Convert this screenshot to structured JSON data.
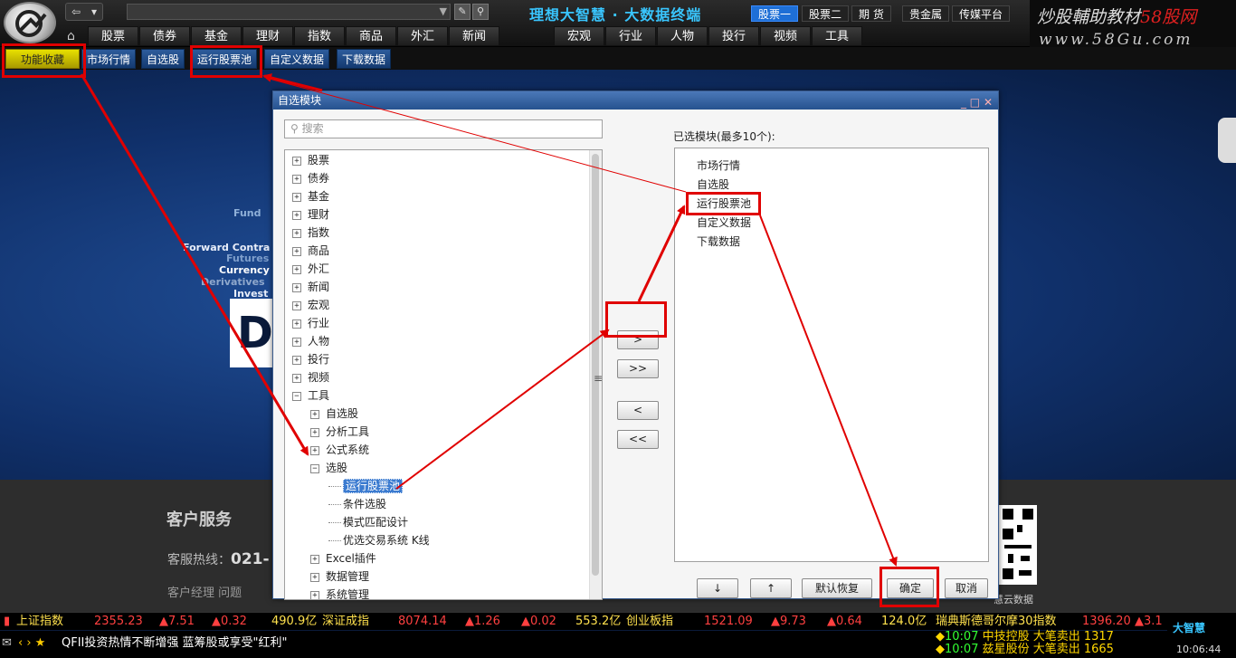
{
  "toolbar": {
    "brand": "理想大智慧 · 大数据终端"
  },
  "watermark": {
    "line1_a": "炒股輔助教材",
    "line1_b": "58股网",
    "line2": "www.58Gu.com"
  },
  "segments": [
    "股票一",
    "股票二",
    "期  货",
    "贵金属",
    "传媒平台"
  ],
  "tabs_left": [
    "股票",
    "债券",
    "基金",
    "理财",
    "指数",
    "商品",
    "外汇",
    "新闻"
  ],
  "tabs_mid": [
    "宏观",
    "行业",
    "人物",
    "投行",
    "视频",
    "工具"
  ],
  "subnav": {
    "fav": "功能收藏",
    "market": "市场行情",
    "self": "自选股",
    "pool": "运行股票池",
    "custom": "自定义数据",
    "download": "下载数据"
  },
  "background": {
    "words": [
      "Fund",
      "Forward Contra",
      "Futures",
      "Currency",
      "Derivatives",
      "Invest"
    ],
    "cs_title": "客户服务",
    "cs_hotline_label": "客服热线：",
    "cs_hotline": "021-",
    "cs_mgr": "客户经理    问题",
    "qr_label": "慧云数据"
  },
  "dialog": {
    "title": "自选模块",
    "search_placeholder": "搜索",
    "selected_title": "已选模块(最多10个):",
    "tree_top": [
      "股票",
      "债券",
      "基金",
      "理财",
      "指数",
      "商品",
      "外汇",
      "新闻",
      "宏观",
      "行业",
      "人物",
      "投行",
      "视频"
    ],
    "tree_tools": "工具",
    "tree_tools_children": [
      "自选股",
      "分析工具",
      "公式系统"
    ],
    "tree_select": "选股",
    "tree_select_children": [
      "运行股票池",
      "条件选股",
      "模式匹配设计",
      "优选交易系统 K线"
    ],
    "tree_tail": [
      "Excel插件",
      "数据管理",
      "系统管理"
    ],
    "selected_items": [
      "市场行情",
      "自选股",
      "运行股票池",
      "自定义数据",
      "下载数据"
    ],
    "btn_add": ">",
    "btn_addall": ">>",
    "btn_remove": "<",
    "btn_removeall": "<<",
    "btn_down": "↓",
    "btn_up": "↑",
    "btn_reset": "默认恢复",
    "btn_ok": "确定",
    "btn_cancel": "取消"
  },
  "ticker": {
    "sh_name": "上证指数",
    "sh_val": "2355.23",
    "sh_chg": "▲7.51",
    "sh_pct": "▲0.32",
    "sh_amt": "490.9亿",
    "sz_name": "深证成指",
    "sz_val": "8074.14",
    "sz_chg": "▲1.26",
    "sz_pct": "▲0.02",
    "sz_amt": "553.2亿",
    "cy_name": "创业板指",
    "cy_val": "1521.09",
    "cy_chg": "▲9.73",
    "cy_pct": "▲0.64",
    "cy_amt": "124.0亿",
    "om_name": "瑞典斯德哥尔摩30指数",
    "om_val": "1396.20",
    "om_chg": "▲3.1"
  },
  "news": {
    "nav": "‹ › ★",
    "text": "QFII投资热情不断增强 蓝筹股或享受\"红利\""
  },
  "alerts": [
    {
      "time": "10:07",
      "text": "中技控股 大笔卖出 1317"
    },
    {
      "time": "10:07",
      "text": "兹星股份 大笔卖出 1665"
    }
  ],
  "corner": {
    "logo": "大智慧",
    "clock": "10:06:44"
  },
  "colors": {
    "highlight": "#e00000",
    "accent": "#39c6ff",
    "selection": "#3b7bd0"
  }
}
